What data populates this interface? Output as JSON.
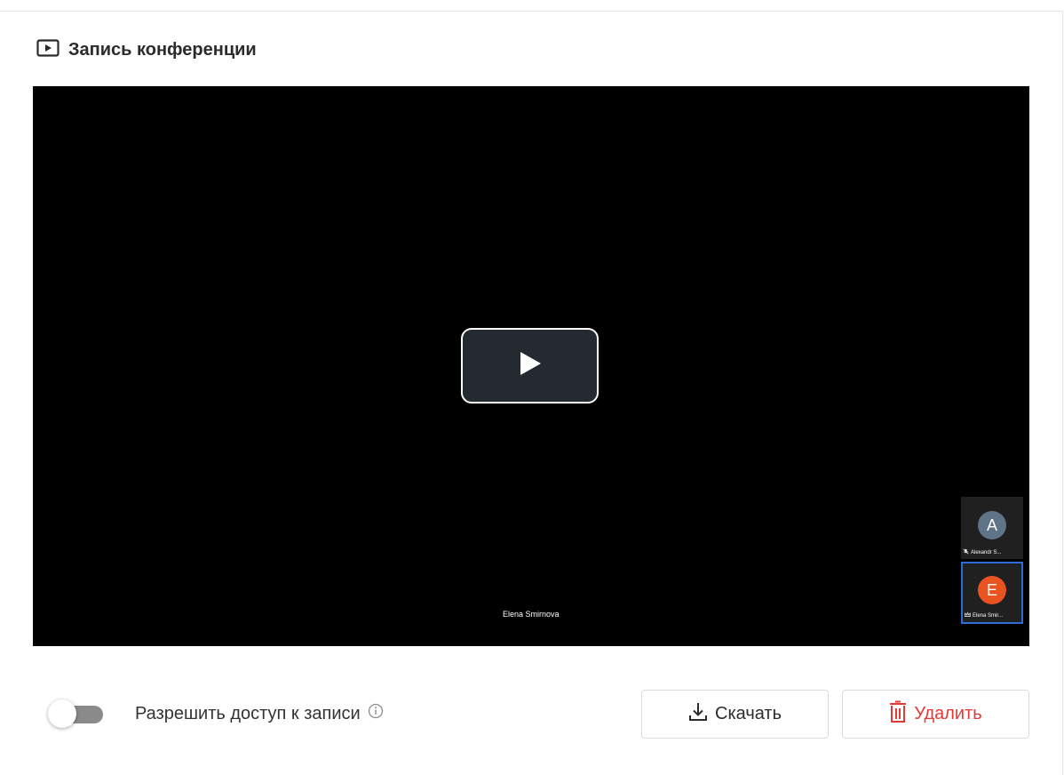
{
  "section": {
    "title": "Запись конференции",
    "icon": "play-rectangle-icon"
  },
  "video": {
    "speaker_name": "Elena Smirnova",
    "play_icon": "play-icon",
    "participants": [
      {
        "initial": "A",
        "name": "Alexandr S...",
        "avatar_color": "#5f7486",
        "status_icon": "mic-off-icon",
        "active": false
      },
      {
        "initial": "E",
        "name": "Elena Smir...",
        "avatar_color": "#e8531f",
        "status_icon": "crown-icon",
        "active": true
      }
    ],
    "active_border_color": "#2f6cd8"
  },
  "controls": {
    "access_toggle": {
      "label": "Разрешить доступ к записи",
      "on": false,
      "info_icon": "info-icon"
    },
    "download_label": "Скачать",
    "delete_label": "Удалить",
    "delete_color": "#e53935"
  }
}
